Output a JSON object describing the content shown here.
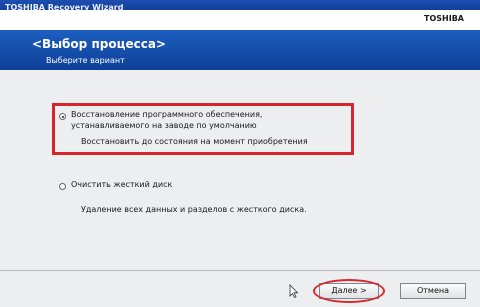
{
  "window": {
    "title": "TOSHIBA Recovery Wizard",
    "brand": "TOSHIBA"
  },
  "header": {
    "title": "<Выбор процесса>",
    "subtitle": "Выберите вариант"
  },
  "options": [
    {
      "selected": true,
      "line1": "Восстановление программного обеспечения,",
      "line2": "устанавливаемого на заводе по умолчанию",
      "description": "Восстановить до состояния на момент приобретения"
    },
    {
      "selected": false,
      "line1": "Очистить жесткий диск",
      "description": "Удаление всех данных и разделов с жесткого диска."
    }
  ],
  "buttons": {
    "next": "Далее >",
    "cancel": "Отмена"
  },
  "colors": {
    "header_blue": "#1d5fbf",
    "highlight_red": "#d8242c"
  }
}
